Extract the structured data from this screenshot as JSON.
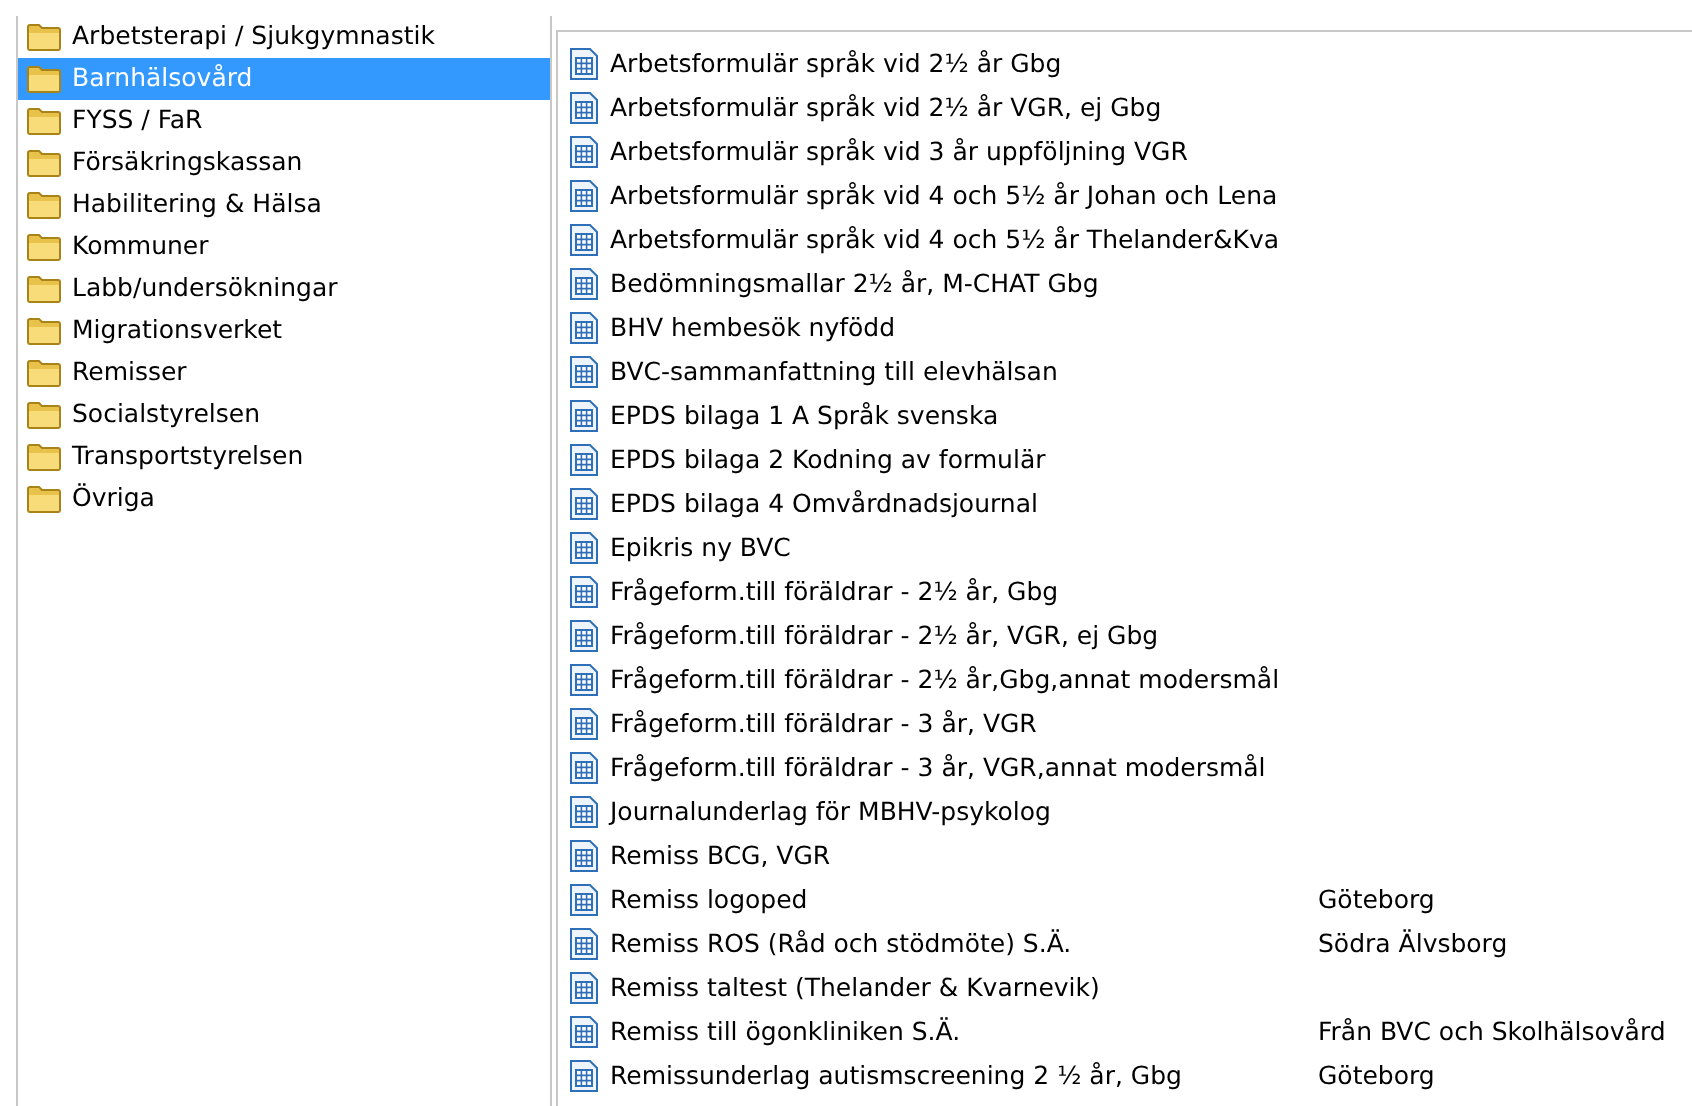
{
  "folders": [
    {
      "label": "Arbetsterapi / Sjukgymnastik",
      "selected": false
    },
    {
      "label": "Barnhälsovård",
      "selected": true
    },
    {
      "label": "FYSS / FaR",
      "selected": false
    },
    {
      "label": "Försäkringskassan",
      "selected": false
    },
    {
      "label": "Habilitering & Hälsa",
      "selected": false
    },
    {
      "label": "Kommuner",
      "selected": false
    },
    {
      "label": "Labb/undersökningar",
      "selected": false
    },
    {
      "label": "Migrationsverket",
      "selected": false
    },
    {
      "label": "Remisser",
      "selected": false
    },
    {
      "label": "Socialstyrelsen",
      "selected": false
    },
    {
      "label": "Transportstyrelsen",
      "selected": false
    },
    {
      "label": "Övriga",
      "selected": false
    }
  ],
  "documents": [
    {
      "name": "Arbetsformulär språk vid 2½ år Gbg"
    },
    {
      "name": "Arbetsformulär språk vid 2½ år VGR, ej Gbg"
    },
    {
      "name": "Arbetsformulär språk vid 3 år uppföljning VGR"
    },
    {
      "name": "Arbetsformulär språk vid 4 och 5½ år Johan och Lena"
    },
    {
      "name": "Arbetsformulär språk vid 4 och 5½ år Thelander&Kva"
    },
    {
      "name": "Bedömningsmallar 2½ år, M-CHAT Gbg"
    },
    {
      "name": "BHV hembesök nyfödd"
    },
    {
      "name": "BVC-sammanfattning till elevhälsan"
    },
    {
      "name": "EPDS bilaga 1 A Språk svenska"
    },
    {
      "name": "EPDS bilaga 2 Kodning av formulär"
    },
    {
      "name": "EPDS bilaga 4 Omvårdnadsjournal"
    },
    {
      "name": "Epikris ny BVC"
    },
    {
      "name": "Frågeform.till föräldrar - 2½ år, Gbg"
    },
    {
      "name": "Frågeform.till föräldrar - 2½ år, VGR, ej Gbg"
    },
    {
      "name": "Frågeform.till föräldrar - 2½ år,Gbg,annat modersmål"
    },
    {
      "name": "Frågeform.till föräldrar - 3 år, VGR"
    },
    {
      "name": "Frågeform.till föräldrar - 3 år, VGR,annat modersmål"
    },
    {
      "name": "Journalunderlag för MBHV-psykolog"
    },
    {
      "name": "Remiss BCG, VGR"
    },
    {
      "name": "Remiss logoped",
      "column_2": "Göteborg"
    },
    {
      "name": "Remiss ROS (Råd och stödmöte) S.Ä.",
      "column_2": "Södra Älvsborg"
    },
    {
      "name": "Remiss taltest (Thelander & Kvarnevik)"
    },
    {
      "name": "Remiss till ögonkliniken S.Ä.",
      "column_2": "Från BVC och Skolhälsovård"
    },
    {
      "name": "Remissunderlag autismscreening 2 ½ år, Gbg",
      "column_2": "Göteborg"
    }
  ]
}
